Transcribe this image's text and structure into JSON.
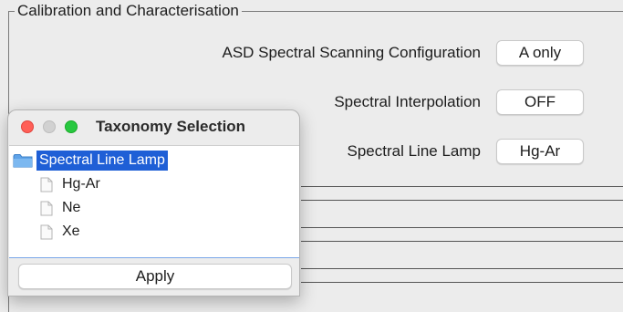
{
  "panel": {
    "title": "Calibration and Characterisation",
    "rows": [
      {
        "label": "ASD Spectral Scanning Configuration",
        "value": "A only"
      },
      {
        "label": "Spectral Interpolation",
        "value": "OFF"
      },
      {
        "label": "Spectral Line Lamp",
        "value": "Hg-Ar"
      }
    ]
  },
  "dialog": {
    "title": "Taxonomy Selection",
    "tree": {
      "root": "Spectral Line Lamp",
      "root_icon": "folder-icon",
      "leaves": [
        "Hg-Ar",
        "Ne",
        "Xe"
      ],
      "leaf_icon": "file-icon"
    },
    "apply_label": "Apply"
  },
  "colors": {
    "selection": "#1f5fd6",
    "close": "#ff5f57",
    "zoom": "#28c840"
  }
}
